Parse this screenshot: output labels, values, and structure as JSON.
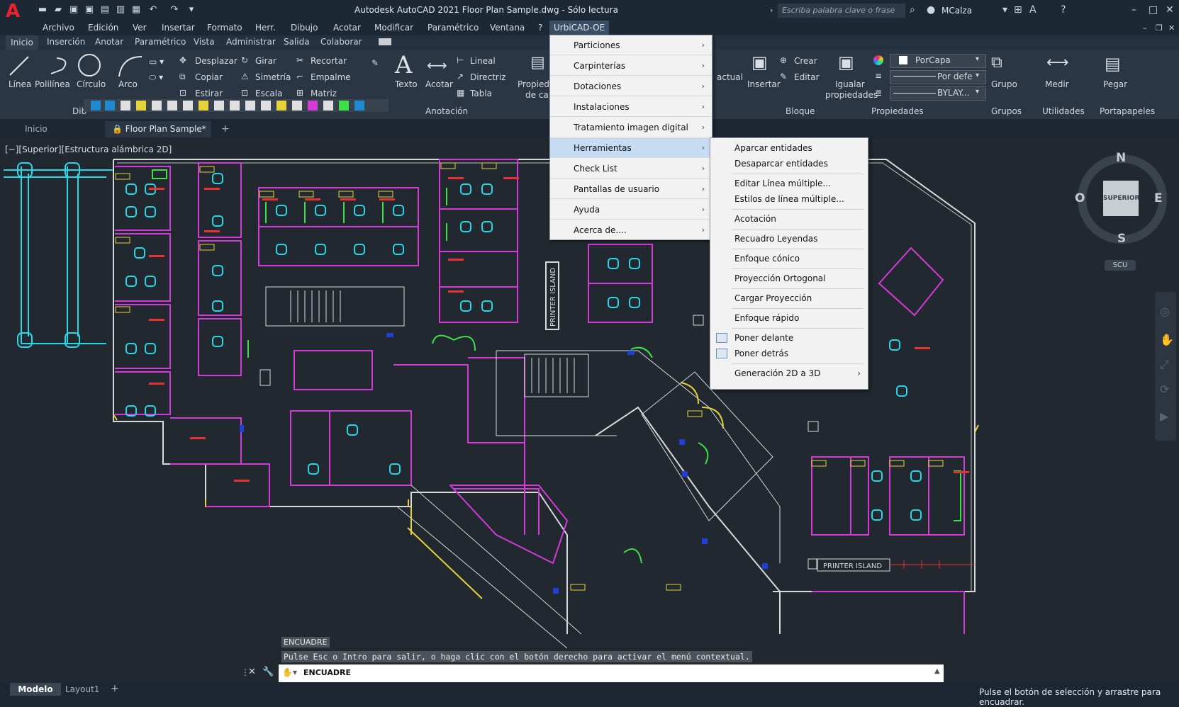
{
  "title": "Autodesk AutoCAD 2021     Floor Plan Sample.dwg - Sólo lectura",
  "app_logo": "A",
  "search_placeholder": "Escriba palabra clave o frase",
  "user": "MCalza",
  "menubar": [
    "Archivo",
    "Edición",
    "Ver",
    "Insertar",
    "Formato",
    "Herr.",
    "Dibujo",
    "Acotar",
    "Modificar",
    "Paramétrico",
    "Ventana",
    "?",
    "UrbiCAD-OE"
  ],
  "ribbon_tabs": [
    "Inicio",
    "Inserción",
    "Anotar",
    "Paramétrico",
    "Vista",
    "Administrar",
    "Salida",
    "Colaborar"
  ],
  "ribbon": {
    "draw": [
      "Línea",
      "Polilínea",
      "Círculo",
      "Arco"
    ],
    "draw_panel": "Dib",
    "modify": [
      "Desplazar",
      "Girar",
      "Recortar",
      "Copiar",
      "Simetría",
      "Empalme",
      "Estirar",
      "Escala",
      "Matriz"
    ],
    "text": "Texto",
    "dimension": "Acotar",
    "annotation_tools": [
      "Lineal",
      "Directriz",
      "Tabla"
    ],
    "annotation_panel": "Anotación",
    "properties_short": [
      "Propied",
      "de cap"
    ],
    "layer_current": "actual",
    "block": [
      "Insertar",
      "Crear",
      "Editar"
    ],
    "block_panel": "Bloque",
    "match": [
      "Igualar",
      "propiedades"
    ],
    "layer_value": "PorCapa",
    "linetype_value": "Por defe",
    "lineweight_value": "BYLAY...",
    "properties_panel": "Propiedades",
    "group": "Grupo",
    "groups_panel": "Grupos",
    "measure": "Medir",
    "utilities_panel": "Utilidades",
    "paste": "Pegar",
    "clipboard_panel": "Portapapeles"
  },
  "file_tabs": {
    "home": "Inicio",
    "doc": "Floor Plan Sample*"
  },
  "view_label": "[−][Superior][Estructura alámbrica 2D]",
  "dropdown": [
    "Particiones",
    "Carpinterías",
    "Dotaciones",
    "Instalaciones",
    "Tratamiento imagen digital",
    "Herramientas",
    "Check List",
    "Pantallas de usuario",
    "Ayuda",
    "Acerca de...."
  ],
  "dropdown_highlight": "Herramientas",
  "submenu": [
    "Aparcar entidades",
    "Desaparcar entidades",
    "Editar Línea múltiple...",
    "Estilos de línea múltiple...",
    "Acotación",
    "Recuadro Leyendas",
    "Enfoque cónico",
    "Proyección Ortogonal",
    "Cargar Proyección",
    "Enfoque rápido",
    "Poner delante",
    "Poner detrás",
    "Generación 2D a 3D"
  ],
  "viewcube": {
    "top": "SUPERIOR",
    "n": "N",
    "s": "S",
    "e": "E",
    "w": "O",
    "ucs": "SCU"
  },
  "plan_labels": {
    "printer_island": "PRINTER ISLAND"
  },
  "command": {
    "history_1": "ENCUADRE",
    "history_2": "Pulse Esc o Intro para salir, o haga clic con el botón derecho para activar el menú contextual.",
    "input": "ENCUADRE"
  },
  "layout_tabs": [
    "Modelo",
    "Layout1"
  ],
  "status_message": "Pulse el botón de selección y arrastre para encuadrar.",
  "colors": {
    "accent": "#4ea1e6",
    "magenta": "#d23bd6",
    "cyan": "#29d6e6",
    "green": "#3ee04a",
    "yellow": "#e6d23a",
    "white": "#d9d9d9",
    "red": "#e63232"
  }
}
